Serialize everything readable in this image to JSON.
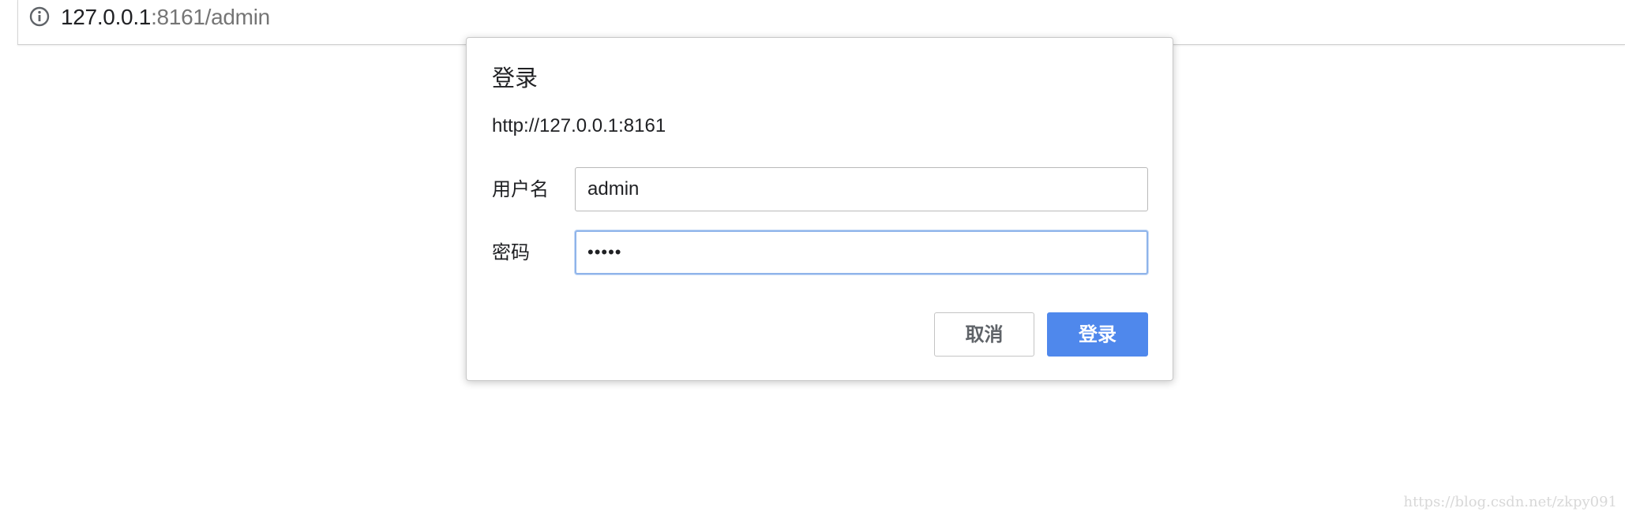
{
  "browser": {
    "address": {
      "host": "127.0.0.1",
      "rest": ":8161/admin"
    },
    "site_info_icon": "info-circle-icon"
  },
  "dialog": {
    "title": "登录",
    "origin": "http://127.0.0.1:8161",
    "username": {
      "label": "用户名",
      "value": "admin"
    },
    "password": {
      "label": "密码",
      "masked_value": "•••••"
    },
    "cancel_label": "取消",
    "login_label": "登录",
    "colors": {
      "primary_button": "#4f88ec",
      "focus_ring": "#8fb4ea"
    }
  },
  "watermark": "https://blog.csdn.net/zkpy091"
}
